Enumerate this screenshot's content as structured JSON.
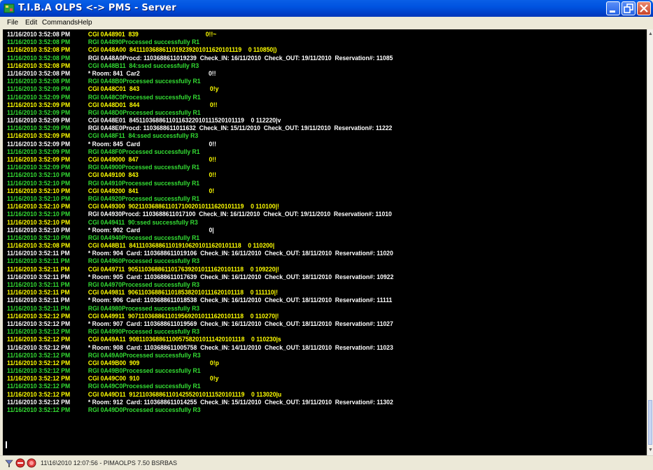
{
  "window": {
    "title": "T.I.B.A  OLPS <-> PMS - Server",
    "colors": {
      "green": "#33dd33",
      "yellow": "#ffff00",
      "white": "#ffffff",
      "console_bg": "#000000"
    }
  },
  "menu": [
    "File",
    "Edit",
    "Commands",
    "Help"
  ],
  "log": [
    {
      "time": "11/16/2010 3:52:08 PM",
      "msg": "CGI 0A48901  839                                        0!!~",
      "tc": "white",
      "mc": "yellow"
    },
    {
      "time": "11/16/2010 3:52:08 PM",
      "msg": "RGI 0A4890Processed successfully R1",
      "tc": "green",
      "mc": "green"
    },
    {
      "time": "11/16/2010 3:52:08 PM",
      "msg": "CGI 0A48A00  8411103688611019239201011620101119    0 110850|)",
      "tc": "yellow",
      "mc": "yellow"
    },
    {
      "time": "11/16/2010 3:52:08 PM",
      "msg": "RGI 0A48A0Procd: 1103688611019239  Check_IN: 16/11/2010  Check_OUT: 19/11/2010  Reservation#: 11085",
      "tc": "green",
      "mc": "white"
    },
    {
      "time": "11/16/2010 3:52:08 PM",
      "msg": "CGI 0A48B11  84:ssed successfully R3",
      "tc": "yellow",
      "mc": "green"
    },
    {
      "time": "11/16/2010 3:52:08 PM",
      "msg": "* Room: 841  Car2                                         0!!",
      "tc": "white",
      "mc": "white"
    },
    {
      "time": "11/16/2010 3:52:08 PM",
      "msg": "RGI 0A48B0Processed successfully R1",
      "tc": "green",
      "mc": "green"
    },
    {
      "time": "11/16/2010 3:52:09 PM",
      "msg": "CGI 0A48C01  843                                          0!y",
      "tc": "green",
      "mc": "yellow"
    },
    {
      "time": "11/16/2010 3:52:09 PM",
      "msg": "RGI 0A48C0Processed successfully R1",
      "tc": "green",
      "mc": "green"
    },
    {
      "time": "11/16/2010 3:52:09 PM",
      "msg": "CGI 0A48D01  844                                          0!!",
      "tc": "yellow",
      "mc": "yellow"
    },
    {
      "time": "11/16/2010 3:52:09 PM",
      "msg": "RGI 0A48D0Processed successfully R1",
      "tc": "green",
      "mc": "green"
    },
    {
      "time": "11/16/2010 3:52:09 PM",
      "msg": "CGI 0A48E01  84511036886110116322010111520101119    0 112220|v",
      "tc": "white",
      "mc": "white"
    },
    {
      "time": "11/16/2010 3:52:09 PM",
      "msg": "RGI 0A48E0Procd: 1103688611011632  Check_IN: 15/11/2010  Check_OUT: 19/11/2010  Reservation#: 11222",
      "tc": "green",
      "mc": "white"
    },
    {
      "time": "11/16/2010 3:52:09 PM",
      "msg": "CGI 0A48F11  84:ssed successfully R3",
      "tc": "yellow",
      "mc": "green"
    },
    {
      "time": "11/16/2010 3:52:09 PM",
      "msg": "* Room: 845  Card                                         0!!",
      "tc": "white",
      "mc": "white"
    },
    {
      "time": "11/16/2010 3:52:09 PM",
      "msg": "RGI 0A48F0Processed successfully R1",
      "tc": "green",
      "mc": "green"
    },
    {
      "time": "11/16/2010 3:52:09 PM",
      "msg": "CGI 0A49000  847                                          0!!",
      "tc": "yellow",
      "mc": "yellow"
    },
    {
      "time": "11/16/2010 3:52:09 PM",
      "msg": "RGI 0A4900Processed successfully R1",
      "tc": "green",
      "mc": "green"
    },
    {
      "time": "11/16/2010 3:52:10 PM",
      "msg": "CGI 0A49100  843                                          0!!",
      "tc": "green",
      "mc": "yellow"
    },
    {
      "time": "11/16/2010 3:52:10 PM",
      "msg": "RGI 0A4910Processed successfully R1",
      "tc": "green",
      "mc": "green"
    },
    {
      "time": "11/16/2010 3:52:10 PM",
      "msg": "CGI 0A49200  841                                          0!",
      "tc": "yellow",
      "mc": "yellow"
    },
    {
      "time": "11/16/2010 3:52:10 PM",
      "msg": "RGI 0A4920Processed successfully R1",
      "tc": "green",
      "mc": "green"
    },
    {
      "time": "11/16/2010 3:52:10 PM",
      "msg": "CGI 0A49300  90211036886110171002010111620101119    0 110100|!",
      "tc": "yellow",
      "mc": "yellow"
    },
    {
      "time": "11/16/2010 3:52:10 PM",
      "msg": "RGI 0A4930Procd: 1103688611017100  Check_IN: 16/11/2010  Check_OUT: 19/11/2010  Reservation#: 11010",
      "tc": "green",
      "mc": "white"
    },
    {
      "time": "11/16/2010 3:52:10 PM",
      "msg": "CGI 0A49411  90:ssed successfully R3",
      "tc": "yellow",
      "mc": "green"
    },
    {
      "time": "11/16/2010 3:52:10 PM",
      "msg": "* Room: 902  Card                                         0|",
      "tc": "white",
      "mc": "white"
    },
    {
      "time": "11/16/2010 3:52:10 PM",
      "msg": "RGI 0A4940Processed successfully R1",
      "tc": "green",
      "mc": "green"
    },
    {
      "time": "11/16/2010 3:52:08 PM",
      "msg": "CGI 0A48B11  8411103688611019106201011620101118    0 110200|",
      "tc": "yellow",
      "mc": "yellow"
    },
    {
      "time": "11/16/2010 3:52:11 PM",
      "msg": "* Room: 904  Card: 1103688611019106  Check_IN: 16/11/2010  Check_OUT: 18/11/2010  Reservation#: 11020",
      "tc": "white",
      "mc": "white"
    },
    {
      "time": "11/16/2010 3:52:11 PM",
      "msg": "RGI 0A4960Processed successfully R3",
      "tc": "green",
      "mc": "green"
    },
    {
      "time": "11/16/2010 3:52:11 PM",
      "msg": "CGI 0A49711  90511036886110176392010111620101118    0 109220|!",
      "tc": "yellow",
      "mc": "yellow"
    },
    {
      "time": "11/16/2010 3:52:11 PM",
      "msg": "* Room: 905  Card: 1103688611017639  Check_IN: 16/11/2010  Check_OUT: 18/11/2010  Reservation#: 10922",
      "tc": "white",
      "mc": "white"
    },
    {
      "time": "11/16/2010 3:52:11 PM",
      "msg": "RGI 0A4970Processed successfully R3",
      "tc": "green",
      "mc": "green"
    },
    {
      "time": "11/16/2010 3:52:11 PM",
      "msg": "CGI 0A49811  90611036886110185382010111620101118    0 111110|!",
      "tc": "yellow",
      "mc": "yellow"
    },
    {
      "time": "11/16/2010 3:52:11 PM",
      "msg": "* Room: 906  Card: 1103688611018538  Check_IN: 16/11/2010  Check_OUT: 18/11/2010  Reservation#: 11111",
      "tc": "white",
      "mc": "white"
    },
    {
      "time": "11/16/2010 3:52:11 PM",
      "msg": "RGI 0A4980Processed successfully R3",
      "tc": "green",
      "mc": "green"
    },
    {
      "time": "11/16/2010 3:52:12 PM",
      "msg": "CGI 0A49911  90711036886110195692010111620101118    0 110270|!",
      "tc": "yellow",
      "mc": "yellow"
    },
    {
      "time": "11/16/2010 3:52:12 PM",
      "msg": "* Room: 907  Card: 1103688611019569  Check_IN: 16/11/2010  Check_OUT: 18/11/2010  Reservation#: 11027",
      "tc": "white",
      "mc": "white"
    },
    {
      "time": "11/16/2010 3:52:12 PM",
      "msg": "RGI 0A4990Processed successfully R3",
      "tc": "green",
      "mc": "green"
    },
    {
      "time": "11/16/2010 3:52:12 PM",
      "msg": "CGI 0A49A11  90811036886110057582010111420101118    0 110230|s",
      "tc": "yellow",
      "mc": "yellow"
    },
    {
      "time": "11/16/2010 3:52:12 PM",
      "msg": "* Room: 908  Card: 1103688611005758  Check_IN: 14/11/2010  Check_OUT: 18/11/2010  Reservation#: 11023",
      "tc": "white",
      "mc": "white"
    },
    {
      "time": "11/16/2010 3:52:12 PM",
      "msg": "RGI 0A49A0Processed successfully R3",
      "tc": "green",
      "mc": "green"
    },
    {
      "time": "11/16/2010 3:52:12 PM",
      "msg": "CGI 0A49B00  909                                          0!p",
      "tc": "yellow",
      "mc": "yellow"
    },
    {
      "time": "11/16/2010 3:52:12 PM",
      "msg": "RGI 0A49B0Processed successfully R1",
      "tc": "green",
      "mc": "green"
    },
    {
      "time": "11/16/2010 3:52:12 PM",
      "msg": "CGI 0A49C00  910                                          0!y",
      "tc": "yellow",
      "mc": "yellow"
    },
    {
      "time": "11/16/2010 3:52:12 PM",
      "msg": "RGI 0A49C0Processed successfully R1",
      "tc": "green",
      "mc": "green"
    },
    {
      "time": "11/16/2010 3:52:12 PM",
      "msg": "CGI 0A49D11  91211036886110142552010111520101119    0 113020|u",
      "tc": "yellow",
      "mc": "yellow"
    },
    {
      "time": "11/16/2010 3:52:12 PM",
      "msg": "* Room: 912  Card: 1103688611014255  Check_IN: 15/11/2010  Check_OUT: 19/11/2010  Reservation#: 11302",
      "tc": "white",
      "mc": "white"
    },
    {
      "time": "11/16/2010 3:52:12 PM",
      "msg": "RGI 0A49D0Processed successfully R3",
      "tc": "green",
      "mc": "green"
    }
  ],
  "status": {
    "text": "11\\16\\2010  12:07:56 - PIMAOLPS 7.50 BSRBAS"
  },
  "icons": [
    "app-icon",
    "minimize-icon",
    "maximize-icon",
    "close-icon",
    "network-status-icon",
    "stop-status-icon",
    "error-status-icon"
  ]
}
